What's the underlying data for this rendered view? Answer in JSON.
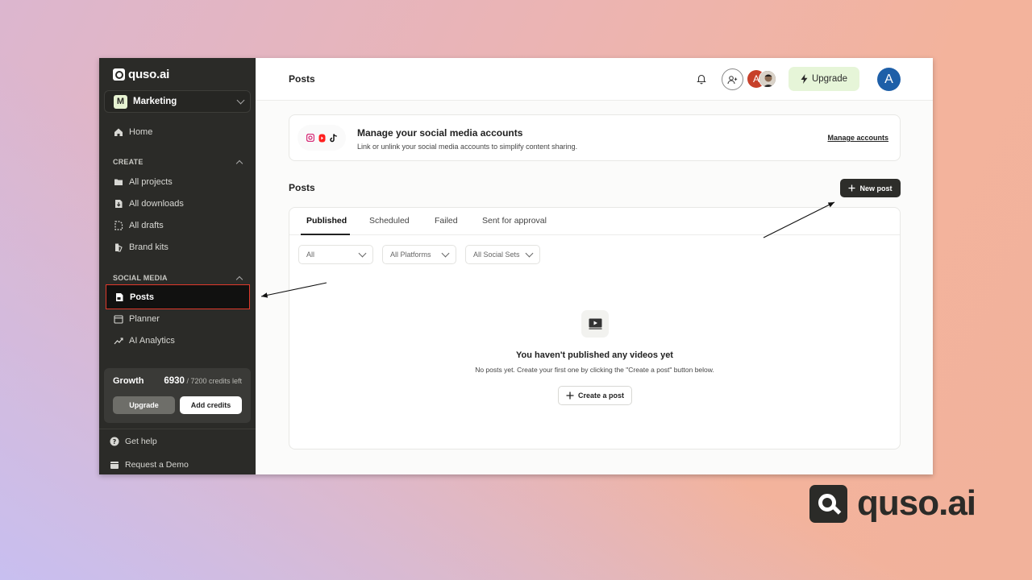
{
  "app": {
    "logo_text": "quso.ai",
    "brand_watermark": "quso.ai"
  },
  "sidebar": {
    "workspace": {
      "badge": "M",
      "name": "Marketing"
    },
    "home": "Home",
    "create_section": "CREATE",
    "create_items": [
      {
        "label": "All projects",
        "icon": "folder-icon"
      },
      {
        "label": "All downloads",
        "icon": "download-icon"
      },
      {
        "label": "All drafts",
        "icon": "draft-icon"
      },
      {
        "label": "Brand kits",
        "icon": "brand-kit-icon"
      }
    ],
    "social_section": "SOCIAL MEDIA",
    "social_items": [
      {
        "label": "Posts",
        "icon": "posts-icon",
        "active": true
      },
      {
        "label": "Planner",
        "icon": "calendar-icon"
      },
      {
        "label": "AI Analytics",
        "icon": "analytics-icon"
      }
    ],
    "credits": {
      "plan": "Growth",
      "used": "6930",
      "suffix": "/ 7200 credits left",
      "upgrade_label": "Upgrade",
      "add_label": "Add credits"
    },
    "footer": [
      {
        "label": "Get help",
        "icon": "help-icon"
      },
      {
        "label": "Request a Demo",
        "icon": "calendar-icon"
      }
    ]
  },
  "header": {
    "title": "Posts",
    "avatar_letter_small": "A",
    "upgrade_label": "Upgrade",
    "avatar_letter": "A"
  },
  "social_card": {
    "title": "Manage your social media accounts",
    "subtitle": "Link or unlink your social media accounts to simplify content sharing.",
    "manage_link": "Manage accounts",
    "icons": [
      "instagram-icon",
      "youtube-shorts-icon",
      "tiktok-icon"
    ]
  },
  "posts": {
    "heading": "Posts",
    "new_post_label": "New post",
    "tabs": [
      "Published",
      "Scheduled",
      "Failed",
      "Sent for approval"
    ],
    "active_tab": "Published",
    "filters": [
      "All",
      "All Platforms",
      "All Social Sets"
    ],
    "empty_title": "You haven't published any videos yet",
    "empty_subtitle": "No posts yet. Create your first one by clicking the \"Create a post\" button below.",
    "create_label": "Create a post"
  },
  "colors": {
    "sidebar_bg": "#2b2b28",
    "highlight_border": "#e0392b",
    "upgrade_bg": "#e6f5d8",
    "avatar_blue": "#1e5fa8"
  }
}
